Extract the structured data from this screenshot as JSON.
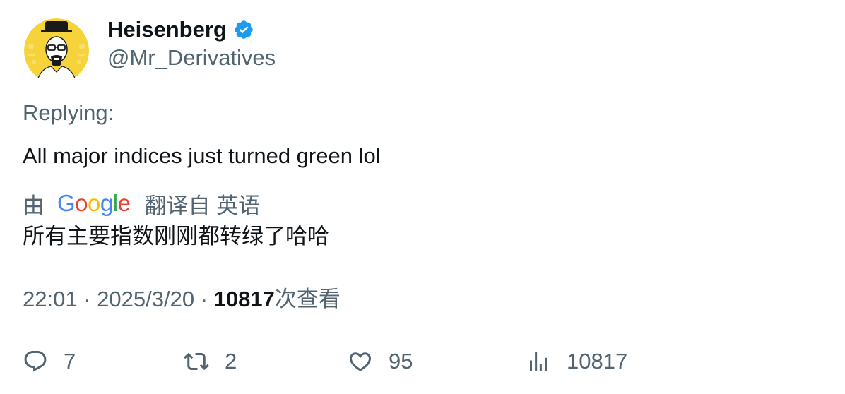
{
  "author": {
    "display_name": "Heisenberg",
    "handle": "@Mr_Derivatives",
    "verified": true
  },
  "replying_label": "Replying:",
  "tweet_text": "All major indices just turned green lol",
  "translation": {
    "by_label": "由",
    "provider": "Google",
    "translated_from": "翻译自 英语",
    "text": "所有主要指数刚刚都转绿了哈哈"
  },
  "meta": {
    "time": "22:01",
    "date": "2025/3/20",
    "separator": "·",
    "views_count": "10817",
    "views_label": "次查看"
  },
  "actions": {
    "reply_count": "7",
    "repost_count": "2",
    "like_count": "95",
    "views_count": "10817"
  },
  "icons": {
    "avatar": "heisenberg-portrait-icon",
    "verified": "verified-badge-icon",
    "reply": "reply-bubble-icon",
    "repost": "repost-arrows-icon",
    "like": "heart-icon",
    "views": "views-bar-chart-icon"
  },
  "colors": {
    "primary_text": "#0f1419",
    "secondary_text": "#536471",
    "verified_blue": "#1d9bf0",
    "avatar_yellow": "#f6d33a",
    "google_blue": "#4285f4",
    "google_red": "#ea4335",
    "google_yellow": "#fbbc05",
    "google_green": "#34a853"
  }
}
